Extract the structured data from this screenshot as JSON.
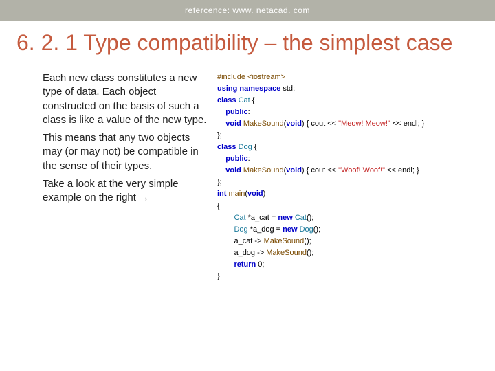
{
  "header": {
    "reference": "refercence: www. netacad. com"
  },
  "title": "6. 2. 1 Type compatibility – the simplest case",
  "body": {
    "p1": "Each new class constitutes a new type of data. Each object constructed on the basis of such a class is like a value of the new type.",
    "p2": "This means that any two objects may (or may not) be compatible in the sense of their types.",
    "p3": "Take a look at the very simple example on the right →"
  },
  "code": {
    "l1a": "#include ",
    "l1b": "<iostream>",
    "l2a": "using namespace ",
    "l2b": "std",
    "l2c": ";",
    "l3a": "class ",
    "l3b": "Cat",
    "l3c": " {",
    "l4a": "public",
    "l4b": ":",
    "l5a": "void ",
    "l5b": "MakeSound",
    "l5c": "(",
    "l5d": "void",
    "l5e": ") { ",
    "l5f": "cout",
    "l5g": " << ",
    "l5h": "\"Meow! Meow!\"",
    "l5i": " << ",
    "l5j": "endl",
    "l5k": "; }",
    "l6": "};",
    "l7a": "class ",
    "l7b": "Dog",
    "l7c": " {",
    "l8a": "public",
    "l8b": ":",
    "l9a": "void ",
    "l9b": "MakeSound",
    "l9c": "(",
    "l9d": "void",
    "l9e": ") { ",
    "l9f": "cout",
    "l9g": " << ",
    "l9h": "\"Woof! Woof!\"",
    "l9i": " << ",
    "l9j": "endl",
    "l9k": "; }",
    "l10": "};",
    "l11a": "int ",
    "l11b": "main",
    "l11c": "(",
    "l11d": "void",
    "l11e": ")",
    "l12": "{",
    "l13a": "Cat",
    "l13b": " *a_cat = ",
    "l13c": "new ",
    "l13d": "Cat",
    "l13e": "();",
    "l14a": "Dog",
    "l14b": " *a_dog = ",
    "l14c": "new ",
    "l14d": "Dog",
    "l14e": "();",
    "l15a": "a_cat -> ",
    "l15b": "MakeSound",
    "l15c": "();",
    "l16a": "a_dog -> ",
    "l16b": "MakeSound",
    "l16c": "();",
    "l17a": "return ",
    "l17b": "0",
    "l17c": ";",
    "l18": "}"
  }
}
